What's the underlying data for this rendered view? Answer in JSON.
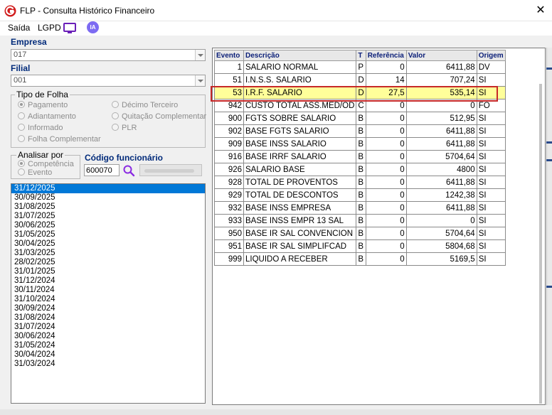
{
  "window": {
    "title": "FLP - Consulta Histórico Financeiro",
    "close_label": "✕"
  },
  "menu": {
    "saida": "Saída",
    "lgpd": "LGPD",
    "ia": "IA"
  },
  "empresa": {
    "label": "Empresa",
    "value": "017"
  },
  "filial": {
    "label": "Filial",
    "value": "001"
  },
  "tipo_folha": {
    "title": "Tipo de Folha",
    "options": [
      "Pagamento",
      "Adiantamento",
      "Informado",
      "Folha Complementar",
      "Décimo Terceiro",
      "Quitação Complementar",
      "PLR"
    ],
    "selected": "Pagamento"
  },
  "analisar_por": {
    "title": "Analisar por",
    "options": [
      "Competência",
      "Evento"
    ],
    "selected": "Competência"
  },
  "codigo_funcionario": {
    "label": "Código funcionário",
    "value": "600070"
  },
  "dates": [
    "31/12/2025",
    "30/09/2025",
    "31/08/2025",
    "31/07/2025",
    "30/06/2025",
    "31/05/2025",
    "30/04/2025",
    "31/03/2025",
    "28/02/2025",
    "31/01/2025",
    "31/12/2024",
    "30/11/2024",
    "31/10/2024",
    "30/09/2024",
    "31/08/2024",
    "31/07/2024",
    "30/06/2024",
    "31/05/2024",
    "30/04/2024",
    "31/03/2024"
  ],
  "selected_date": "31/12/2025",
  "grid": {
    "columns": [
      "Evento",
      "Descrição",
      "T",
      "Referência",
      "Valor",
      "Origem"
    ],
    "rows": [
      [
        "1",
        "SALARIO NORMAL",
        "P",
        "0",
        "6411,88",
        "DV"
      ],
      [
        "51",
        "I.N.S.S. SALARIO",
        "D",
        "14",
        "707,24",
        "SI"
      ],
      [
        "53",
        "I.R.F. SALARIO",
        "D",
        "27,5",
        "535,14",
        "SI"
      ],
      [
        "942",
        "CUSTO TOTAL ASS.MED/OD",
        "C",
        "0",
        "0",
        "FO"
      ],
      [
        "900",
        "FGTS SOBRE SALARIO",
        "B",
        "0",
        "512,95",
        "SI"
      ],
      [
        "902",
        "BASE FGTS SALARIO",
        "B",
        "0",
        "6411,88",
        "SI"
      ],
      [
        "909",
        "BASE INSS SALARIO",
        "B",
        "0",
        "6411,88",
        "SI"
      ],
      [
        "916",
        "BASE IRRF SALARIO",
        "B",
        "0",
        "5704,64",
        "SI"
      ],
      [
        "926",
        "SALARIO BASE",
        "B",
        "0",
        "4800",
        "SI"
      ],
      [
        "928",
        "TOTAL DE PROVENTOS",
        "B",
        "0",
        "6411,88",
        "SI"
      ],
      [
        "929",
        "TOTAL DE DESCONTOS",
        "B",
        "0",
        "1242,38",
        "SI"
      ],
      [
        "932",
        "BASE INSS EMPRESA",
        "B",
        "0",
        "6411,88",
        "SI"
      ],
      [
        "933",
        "BASE INSS EMPR 13 SAL",
        "B",
        "0",
        "0",
        "SI"
      ],
      [
        "950",
        "BASE IR SAL CONVENCION",
        "B",
        "0",
        "5704,64",
        "SI"
      ],
      [
        "951",
        "BASE IR SAL SIMPLIFCAD",
        "B",
        "0",
        "5804,68",
        "SI"
      ],
      [
        "999",
        "LIQUIDO A RECEBER",
        "B",
        "0",
        "5169,5",
        "SI"
      ]
    ],
    "highlighted_row": 2
  },
  "colors": {
    "label_blue": "#002a7a",
    "selection": "#0078d7",
    "highlight": "#ffff9a",
    "outline": "#c62828",
    "ia_badge": "#7d6bf2"
  }
}
